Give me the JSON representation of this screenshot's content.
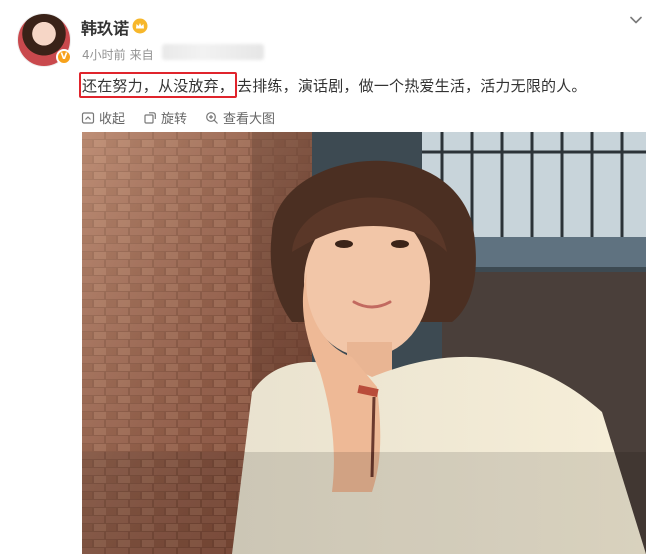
{
  "user": {
    "name": "韩玖诺"
  },
  "meta": {
    "time": "4小时前",
    "source": "来自"
  },
  "post": {
    "text_highlight": "还在努力，从没放弃，",
    "text_rest": "去排练，演话剧，做一个热爱生活，活力无限的人。"
  },
  "actions": [
    {
      "label": "收起",
      "icon": "collapse-icon"
    },
    {
      "label": "旋转",
      "icon": "rotate-icon"
    },
    {
      "label": "查看大图",
      "icon": "zoom-in-icon"
    }
  ],
  "colors": {
    "highlight_border": "#e0242c",
    "badge": "#f7a21b",
    "meta_text": "#939393"
  }
}
